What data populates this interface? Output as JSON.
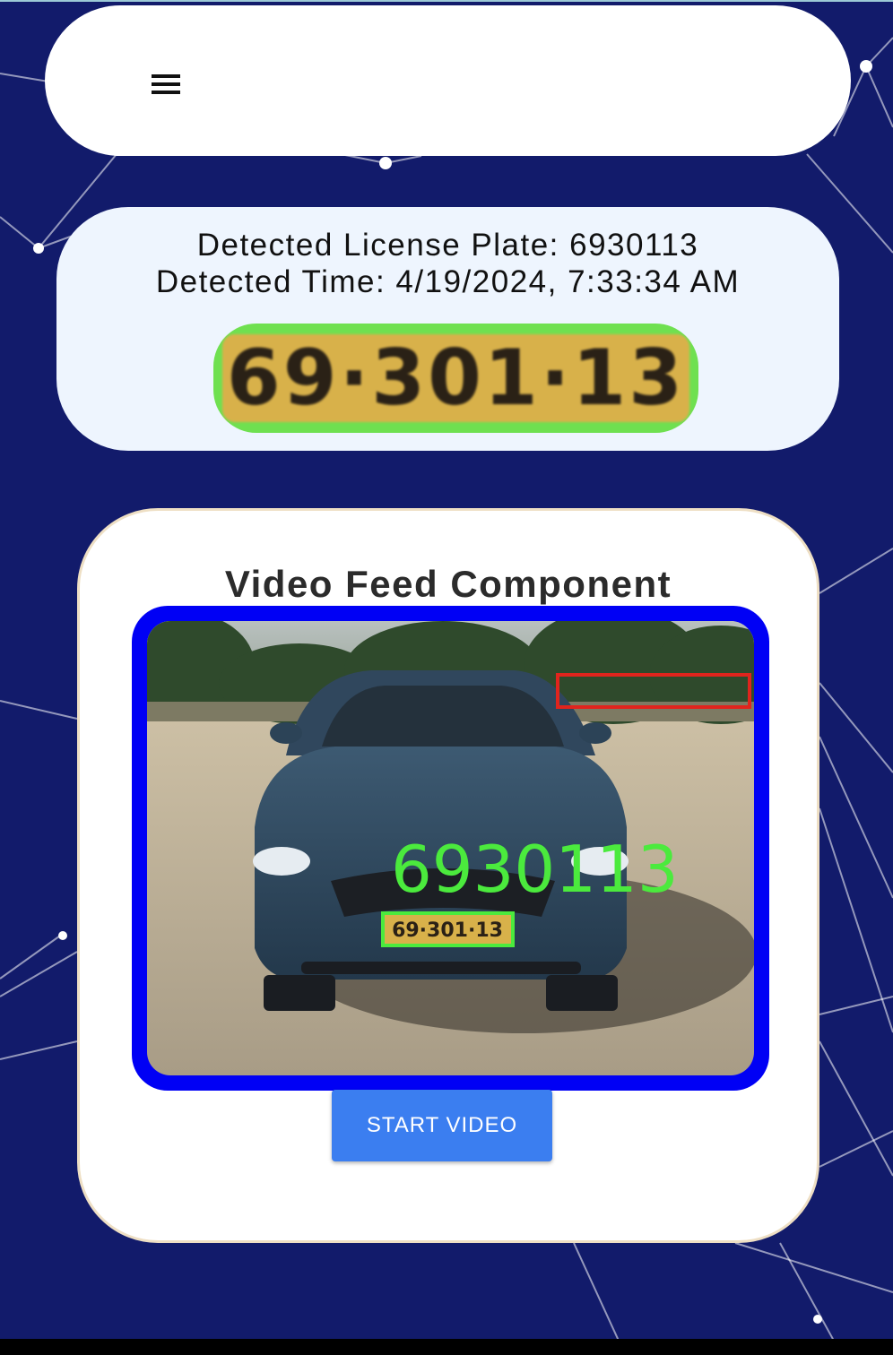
{
  "app": {
    "background_color": "#121b6b"
  },
  "navbar": {
    "menu_icon": "hamburger-menu-icon"
  },
  "detection": {
    "plate_line": "Detected License Plate: 6930113",
    "time_line": "Detected Time: 4/19/2024, 7:33:34 AM",
    "plate_crop_text": "69·301·13",
    "plate_crop_highlight": "#6fe050"
  },
  "video": {
    "title": "Video Feed Component",
    "frame_color": "#0000f5",
    "overlay_plate_text": "6930113",
    "overlay_color": "#4bea3d",
    "plate_text": "69·301·13",
    "start_label": "START VIDEO",
    "start_color": "#3b7ef0"
  }
}
